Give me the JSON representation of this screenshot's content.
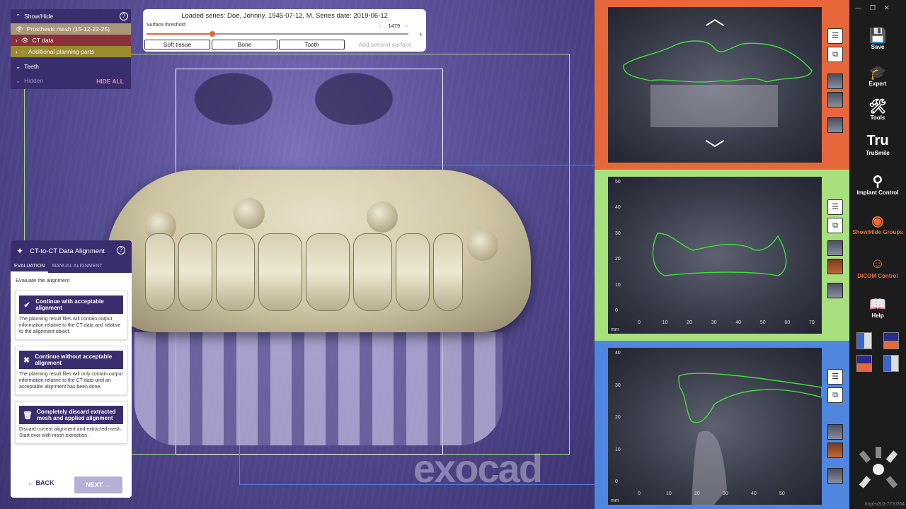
{
  "showhide": {
    "title": "Show/Hide",
    "items": [
      {
        "label": "Prosthesis mesh (15-12-22-25)"
      },
      {
        "label": "CT data"
      },
      {
        "label": "Additional planning parts"
      }
    ],
    "teeth": "Teeth",
    "hidden": "Hidden",
    "hide_all": "HIDE ALL"
  },
  "topbar": {
    "series": "Loaded series: Doe, Johnny, 1945-07-12, M, Series date: 2019-06-12",
    "threshold_label": "Surface threshold",
    "threshold_value": "1479",
    "threshold_fraction": 0.25,
    "buttons": [
      "Soft tissue",
      "Bone",
      "Tooth"
    ],
    "add_surface": "Add second surface"
  },
  "alignment": {
    "title": "CT-to-CT Data Alignment",
    "tabs": [
      "EVALUATION",
      "MANUAL ALIGNMENT"
    ],
    "intro": "Evaluate the alignment",
    "cards": [
      {
        "label": "Continue with acceptable alignment",
        "desc": "The planning result files will contain output information relative to the CT data and relative to the alignment object."
      },
      {
        "label": "Continue without acceptable alignment",
        "desc": "The planning result files will only contain output information relative to the CT data until an acceptable alignment has been done."
      },
      {
        "label": "Completely discard extracted mesh and applied alignment",
        "desc": "Discard current alignment and extracted mesh. Start over with mesh extraction."
      }
    ],
    "back": "BACK",
    "next": "NEXT"
  },
  "viewport": {
    "watermark": "exocad"
  },
  "slices": {
    "coronal": {
      "y_ticks": [
        "50",
        "40",
        "30",
        "20",
        "10",
        "0"
      ],
      "x_ticks": [
        "0",
        "10",
        "20",
        "30",
        "40",
        "50",
        "60",
        "70"
      ],
      "unit": "mm"
    },
    "sagittal": {
      "y_ticks": [
        "40",
        "30",
        "20",
        "10",
        "0"
      ],
      "x_ticks": [
        "0",
        "10",
        "20",
        "30",
        "40",
        "50"
      ],
      "unit": "mm"
    }
  },
  "appbar": {
    "items": [
      {
        "label": "Save",
        "icon": "save-icon"
      },
      {
        "label": "Expert",
        "icon": "graduation-cap-icon"
      },
      {
        "label": "Tools",
        "icon": "tools-icon"
      },
      {
        "label": "TruSmile",
        "icon": "trusmile-icon"
      },
      {
        "label": "Implant Control",
        "icon": "implant-icon"
      },
      {
        "label": "Show/Hide Groups",
        "icon": "eye-icon"
      },
      {
        "label": "DICOM Control",
        "icon": "dicom-icon"
      },
      {
        "label": "Help",
        "icon": "book-icon"
      }
    ],
    "version": "Impl-v3.0-7737/64"
  },
  "colors": {
    "panel_top": "#e8673a",
    "panel_mid": "#a7e07c",
    "panel_bottom": "#4f86e0",
    "brand": "#3a2d6e",
    "accent": "#e0683a",
    "contour": "#3ee03a"
  }
}
